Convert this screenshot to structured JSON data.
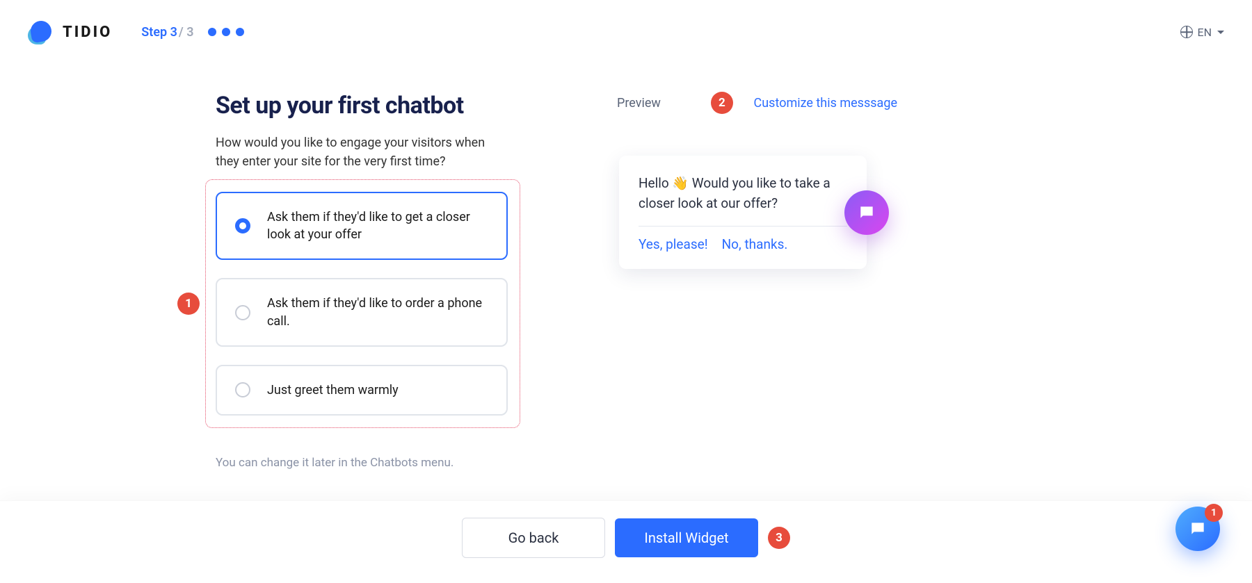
{
  "header": {
    "brand": "TIDIO",
    "step_current": "Step 3",
    "step_total": "/ 3",
    "lang": "EN"
  },
  "main": {
    "title": "Set up your first chatbot",
    "subtitle": "How would you like to engage your visitors when they enter your site for the very first time?",
    "options": [
      {
        "label": "Ask them if they'd like to get a closer look at your offer",
        "selected": true
      },
      {
        "label": "Ask them if they'd like to order a phone call.",
        "selected": false
      },
      {
        "label": "Just greet them warmly",
        "selected": false
      }
    ],
    "change_later": "You can change it later in the Chatbots menu."
  },
  "preview": {
    "label": "Preview",
    "customize": "Customize this messsage",
    "chat_message": "Hello 👋 Would you like to take a closer look at our offer?",
    "yes": "Yes, please!",
    "no": "No, thanks."
  },
  "footer": {
    "back": "Go back",
    "install": "Install Widget"
  },
  "annotations": {
    "a1": "1",
    "a2": "2",
    "a3": "3"
  },
  "floating_chat": {
    "badge": "1"
  }
}
